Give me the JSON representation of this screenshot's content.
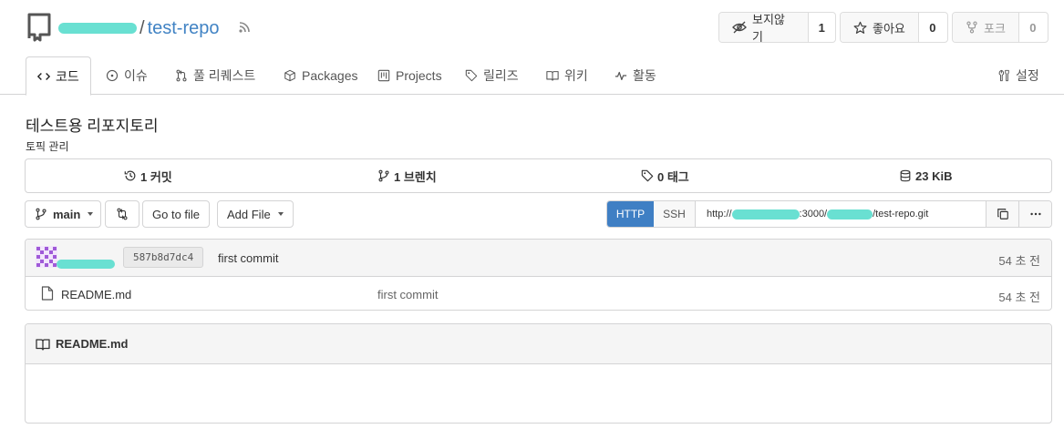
{
  "repo": {
    "name": "test-repo",
    "description": "테스트용 리포지토리",
    "topics_label": "토픽 관리"
  },
  "header": {
    "watch": {
      "label": "보지않기",
      "count": "1"
    },
    "star": {
      "label": "좋아요",
      "count": "0"
    },
    "fork": {
      "label": "포크",
      "count": "0"
    }
  },
  "tabs": [
    {
      "label": "코드",
      "icon": "code-icon"
    },
    {
      "label": "이슈",
      "icon": "issue-icon"
    },
    {
      "label": "풀 리퀘스트",
      "icon": "pull-request-icon"
    },
    {
      "label": "Packages",
      "icon": "package-icon"
    },
    {
      "label": "Projects",
      "icon": "project-icon"
    },
    {
      "label": "릴리즈",
      "icon": "tag-icon"
    },
    {
      "label": "위키",
      "icon": "book-icon"
    },
    {
      "label": "활동",
      "icon": "pulse-icon"
    },
    {
      "label": "설정",
      "icon": "tools-icon"
    }
  ],
  "stats": {
    "commits": "1 커밋",
    "branches": "1 브렌치",
    "tags": "0 태그",
    "size": "23 KiB"
  },
  "toolbar": {
    "branch": "main",
    "go_to_file": "Go to file",
    "add_file": "Add File"
  },
  "clone": {
    "http_label": "HTTP",
    "ssh_label": "SSH",
    "url_prefix": "http://",
    "url_port": ":3000/",
    "url_suffix": "/test-repo.git"
  },
  "latest_commit": {
    "sha": "587b8d7dc4",
    "message": "first commit",
    "time": "54 초 전"
  },
  "files": [
    {
      "name": "README.md",
      "message": "first commit",
      "time": "54 초 전"
    }
  ],
  "readme": {
    "title": "README.md"
  },
  "colors": {
    "link": "#4183c4",
    "primary": "#3f7fc4",
    "redaction": "#69e0d2"
  }
}
